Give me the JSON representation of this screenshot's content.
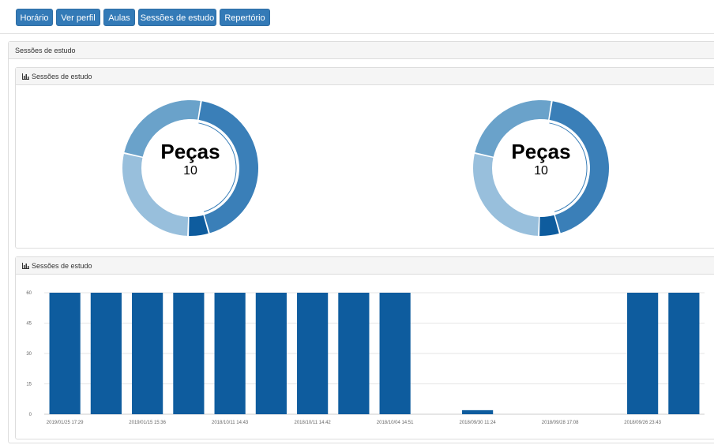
{
  "nav": {
    "buttons": [
      "Horário",
      "Ver perfil",
      "Aulas",
      "Sessões de estudo",
      "Repertório"
    ]
  },
  "outer_panel": {
    "title": "Sessões de estudo"
  },
  "donut_panel": {
    "title": "Sessões de estudo",
    "title_icon": "bar-chart-icon",
    "donuts": [
      {
        "title": "Peças",
        "value": "10"
      },
      {
        "title": "Peças",
        "value": "10"
      }
    ]
  },
  "bar_panel": {
    "title": "Sessões de estudo",
    "title_icon": "bar-chart-icon"
  },
  "colors": {
    "accent": "#337ab7",
    "bar": "#0e5c9e",
    "donut_segments": [
      "#3a7fb8",
      "#0e5c9e",
      "#98bfdc",
      "#6aa2ca"
    ]
  },
  "chart_data": [
    {
      "type": "pie",
      "title": "Peças",
      "center_value": "10",
      "donut": true,
      "segments": [
        {
          "value": 43,
          "color": "#3a7fb8"
        },
        {
          "value": 5,
          "color": "#0e5c9e"
        },
        {
          "value": 28,
          "color": "#98bfdc"
        },
        {
          "value": 24,
          "color": "#6aa2ca"
        }
      ]
    },
    {
      "type": "pie",
      "title": "Peças",
      "center_value": "10",
      "donut": true,
      "segments": [
        {
          "value": 43,
          "color": "#3a7fb8"
        },
        {
          "value": 5,
          "color": "#0e5c9e"
        },
        {
          "value": 28,
          "color": "#98bfdc"
        },
        {
          "value": 24,
          "color": "#6aa2ca"
        }
      ]
    },
    {
      "type": "bar",
      "ylim": [
        0,
        60
      ],
      "yticks": [
        0,
        15,
        30,
        45,
        60
      ],
      "values": [
        60,
        60,
        60,
        60,
        60,
        60,
        60,
        60,
        60,
        0,
        2,
        0,
        0,
        0,
        60,
        60
      ],
      "xtick_labels": [
        "2019/01/25 17:29",
        "2019/01/15 15:36",
        "2018/10/11 14:43",
        "2018/10/11 14:42",
        "2018/10/04 14:51",
        "2018/09/30 11:24",
        "2018/09/28 17:08",
        "2018/09/26 23:43"
      ],
      "xtick_every": 2,
      "grid": true,
      "xlabel": "",
      "ylabel": ""
    }
  ]
}
